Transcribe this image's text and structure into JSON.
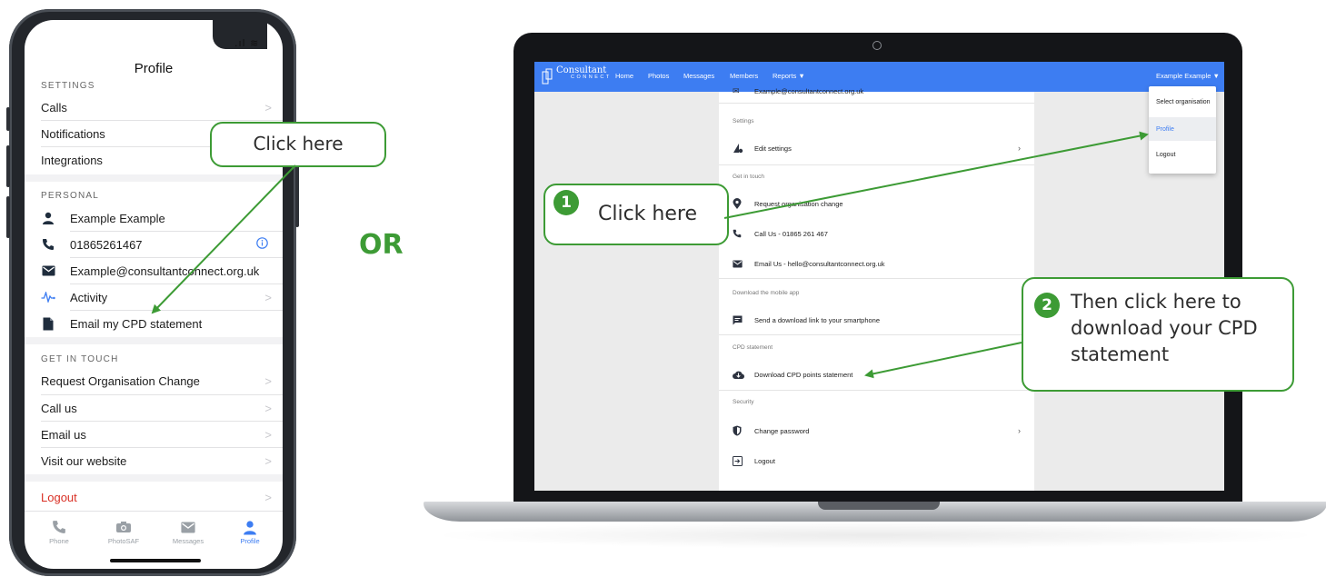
{
  "phone": {
    "title": "Profile",
    "settings_header": "SETTINGS",
    "settings_items": [
      {
        "label": "Calls",
        "icon": "chevron-right-icon"
      },
      {
        "label": "Notifications",
        "icon": "chevron-right-icon"
      },
      {
        "label": "Integrations",
        "icon": "chevron-right-icon"
      }
    ],
    "personal_header": "PERSONAL",
    "personal_items": [
      {
        "label": "Example Example",
        "icon": "person-icon"
      },
      {
        "label": "01865261467",
        "icon": "phone-icon",
        "trailing": "info-icon"
      },
      {
        "label": "Example@consultantconnect.org.uk",
        "icon": "mail-icon"
      },
      {
        "label": "Activity",
        "icon": "activity-icon"
      },
      {
        "label": "Email my CPD statement",
        "icon": "document-icon"
      }
    ],
    "touch_header": "GET IN TOUCH",
    "touch_items": [
      {
        "label": "Request Organisation Change"
      },
      {
        "label": "Call us"
      },
      {
        "label": "Email us"
      },
      {
        "label": "Visit our website"
      }
    ],
    "logout": "Logout",
    "logout_color": "#d93025",
    "tabs": [
      {
        "label": "Phone",
        "icon": "phone-icon"
      },
      {
        "label": "PhotoSAF",
        "icon": "camera-icon"
      },
      {
        "label": "Messages",
        "icon": "mail-icon"
      },
      {
        "label": "Profile",
        "icon": "person-icon",
        "active": true
      }
    ],
    "active_tab_color": "#3d7df2"
  },
  "callouts": {
    "phone": "Click here",
    "or_label": "OR",
    "step1_number": "1",
    "step1_text": "Click here",
    "step2_number": "2",
    "step2_text_line1": "Then click here to",
    "step2_text_line2": "download your CPD",
    "step2_text_line3": "statement",
    "accent_color": "#3d9b35"
  },
  "web": {
    "brand": "Consultant",
    "brand_sub": "CONNECT",
    "nav": [
      "Home",
      "Photos",
      "Messages",
      "Members",
      "Reports ▼"
    ],
    "user_menu": "Example Example ▼",
    "nav_color": "#3d7df2",
    "dropdown": [
      {
        "label": "Select organisation"
      },
      {
        "label": "Profile",
        "active": true
      },
      {
        "label": "Logout"
      }
    ],
    "truncated_email": "Example@consultantconnect.org.uk",
    "settings_label": "Settings",
    "edit_settings": "Edit settings",
    "get_in_touch_label": "Get in touch",
    "request_change": "Request organisation change",
    "call_us": "Call Us - 01865 261 467",
    "email_us": "Email Us - hello@consultantconnect.org.uk",
    "download_app_label": "Download the mobile app",
    "send_link": "Send a download link to your smartphone",
    "cpd_label": "CPD statement",
    "download_cpd": "Download CPD points statement",
    "security_label": "Security",
    "change_password": "Change password",
    "logout": "Logout"
  }
}
